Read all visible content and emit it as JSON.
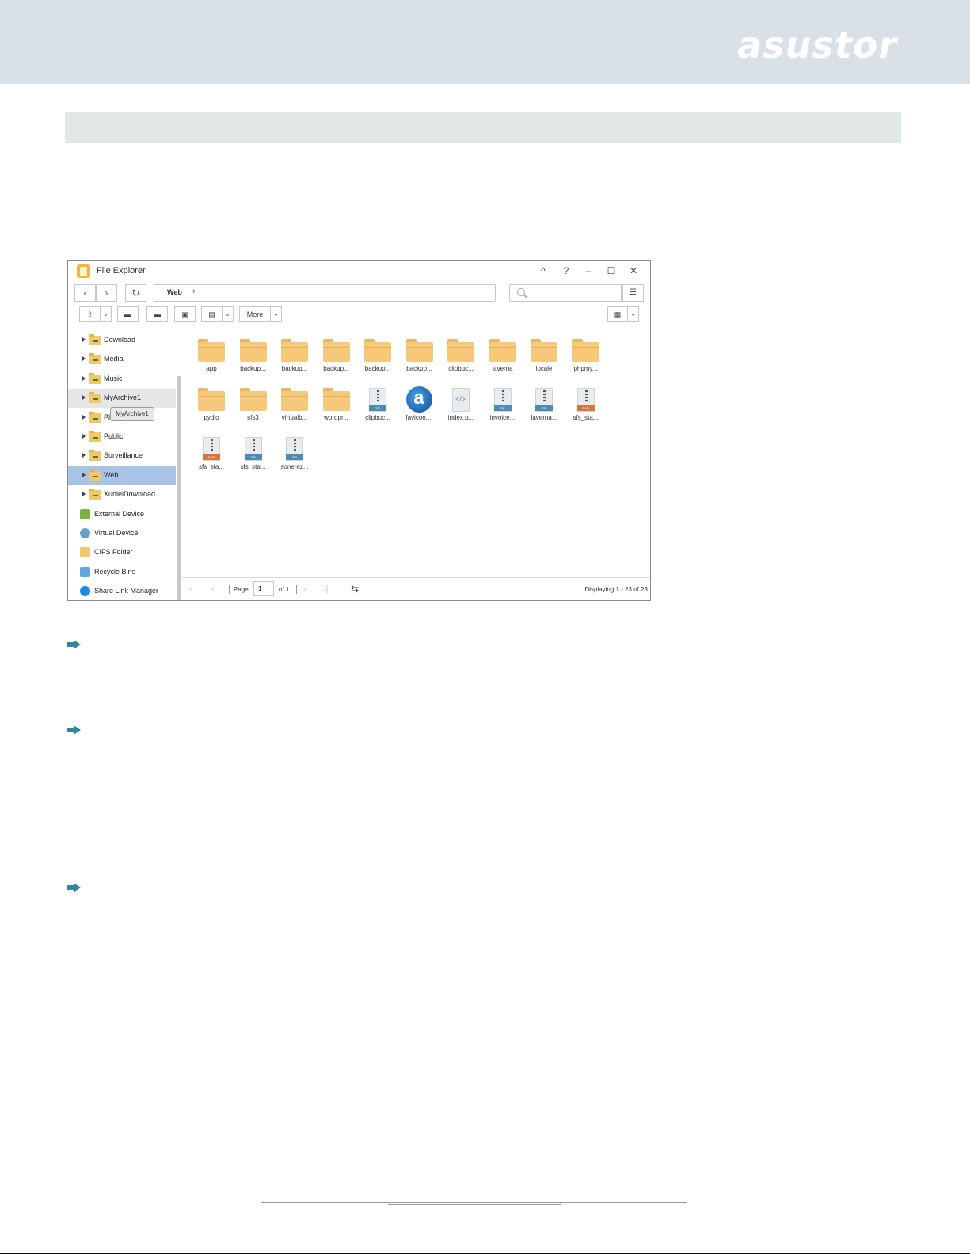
{
  "document": {
    "brand": "asustor",
    "colors": {
      "header_bg": "#d8e1e7",
      "section_bar": "#e1e8e8",
      "arrow": "#2e8a99",
      "selected_row": "#a7c4e7"
    }
  },
  "window": {
    "title": "File Explorer",
    "controls": [
      "^",
      "?",
      "–",
      "☐",
      "✕"
    ],
    "nav": {
      "back": "‹",
      "forward": "›",
      "refresh": "↻"
    },
    "path": {
      "current": "Web",
      "chevron": "›"
    },
    "search": {
      "placeholder": ""
    },
    "toolbar": {
      "upload": "⇧",
      "more_label": "More",
      "caret": "⌄",
      "view": "▦"
    }
  },
  "sidebar": {
    "items": [
      {
        "label": "Download",
        "type": "folder",
        "state": ""
      },
      {
        "label": "Media",
        "type": "folder",
        "state": ""
      },
      {
        "label": "Music",
        "type": "folder",
        "state": ""
      },
      {
        "label": "MyArchive1",
        "type": "folder",
        "state": "hover"
      },
      {
        "label": "Pl",
        "type": "folder",
        "state": ""
      },
      {
        "label": "Public",
        "type": "folder",
        "state": ""
      },
      {
        "label": "Surveillance",
        "type": "folder",
        "state": ""
      },
      {
        "label": "Web",
        "type": "folder",
        "state": "selected"
      },
      {
        "label": "XunleiDownload",
        "type": "folder",
        "state": ""
      },
      {
        "label": "External Device",
        "type": "device",
        "state": ""
      },
      {
        "label": "Virtual Device",
        "type": "device",
        "state": ""
      },
      {
        "label": "CIFS Folder",
        "type": "device",
        "state": ""
      },
      {
        "label": "Recycle Bins",
        "type": "device",
        "state": ""
      },
      {
        "label": "Share Link Manager",
        "type": "device",
        "state": ""
      }
    ],
    "tooltip": "MyArchive1"
  },
  "files": [
    {
      "name": "app",
      "kind": "folder"
    },
    {
      "name": "backup...",
      "kind": "folder"
    },
    {
      "name": "backup...",
      "kind": "folder"
    },
    {
      "name": "backup...",
      "kind": "folder"
    },
    {
      "name": "backup...",
      "kind": "folder"
    },
    {
      "name": "backup...",
      "kind": "folder"
    },
    {
      "name": "clipbuc...",
      "kind": "folder"
    },
    {
      "name": "laverna",
      "kind": "folder"
    },
    {
      "name": "locale",
      "kind": "folder"
    },
    {
      "name": "phpmy...",
      "kind": "folder"
    },
    {
      "name": "pydio",
      "kind": "folder"
    },
    {
      "name": "sfs3",
      "kind": "folder"
    },
    {
      "name": "virtualb...",
      "kind": "folder"
    },
    {
      "name": "wordpr...",
      "kind": "folder"
    },
    {
      "name": "clipbuc...",
      "kind": "zip",
      "badge": "ZIP"
    },
    {
      "name": "favicon....",
      "kind": "favicon",
      "badge": "a"
    },
    {
      "name": "index.p...",
      "kind": "code",
      "badge": "</>"
    },
    {
      "name": "invoice...",
      "kind": "zip",
      "badge": "ZIP"
    },
    {
      "name": "laverna...",
      "kind": "zip",
      "badge": "ZIP"
    },
    {
      "name": "sfs_sta...",
      "kind": "rar",
      "badge": "RAR"
    },
    {
      "name": "sfs_sta...",
      "kind": "rar",
      "badge": "RAR"
    },
    {
      "name": "sfs_sta...",
      "kind": "zip",
      "badge": "ZIP"
    },
    {
      "name": "sonerez...",
      "kind": "zip",
      "badge": "ZIP"
    }
  ],
  "pager": {
    "page_label": "Page",
    "page_value": "1",
    "of_label": "of 1",
    "displaying": "Displaying 1 - 23 of 23",
    "first": "|‹",
    "prev": "‹",
    "next": "›",
    "last": "›|",
    "refresh": "⇆"
  }
}
